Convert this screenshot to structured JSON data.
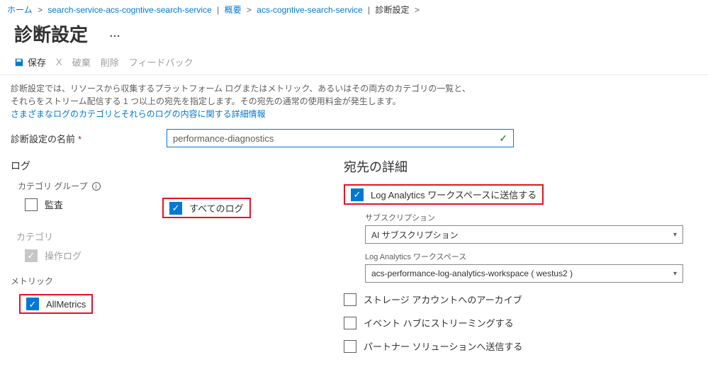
{
  "breadcrumb": {
    "home": "ホーム",
    "svc": "search-service-acs-cogntive-search-service",
    "overview": "概要",
    "svc2": "acs-cogntive-search-service",
    "current": "診断設定"
  },
  "page": {
    "title": "診断設定",
    "ellipsis": "…"
  },
  "toolbar": {
    "save": "保存",
    "close_x": "X",
    "discard": "破棄",
    "delete": "削除",
    "feedback": "フィードバック"
  },
  "help": {
    "line1": "診断設定では、リソースから収集するプラットフォーム ログまたはメトリック、あるいはその両方のカテゴリの一覧と、",
    "line2": "それらをストリーム配信する 1 つ以上の宛先を指定します。その宛先の通常の使用料金が発生します。",
    "link": "さまざまなログのカテゴリとそれらのログの内容に関する詳細情報"
  },
  "name_field": {
    "label": "診断設定の名前",
    "value": "performance-diagnostics"
  },
  "logs": {
    "heading": "ログ",
    "cat_groups_label": "カテゴリ グループ",
    "audit": "監査",
    "all_logs": "すべてのログ",
    "category_label": "カテゴリ",
    "op_log": "操作ログ"
  },
  "metrics": {
    "heading": "メトリック",
    "all_metrics": "AllMetrics"
  },
  "dest": {
    "heading": "宛先の詳細",
    "send_to_la": "Log Analytics ワークスペースに送信する",
    "sub_label": "サブスクリプション",
    "sub_value": "AI サブスクリプション",
    "ws_label": "Log Analytics ワークスペース",
    "ws_value": "acs-performance-log-analytics-workspace ( westus2 )",
    "archive_storage": "ストレージ アカウントへのアーカイブ",
    "stream_eventhub": "イベント ハブにストリーミングする",
    "send_partner": "パートナー ソリューションへ送信する"
  }
}
